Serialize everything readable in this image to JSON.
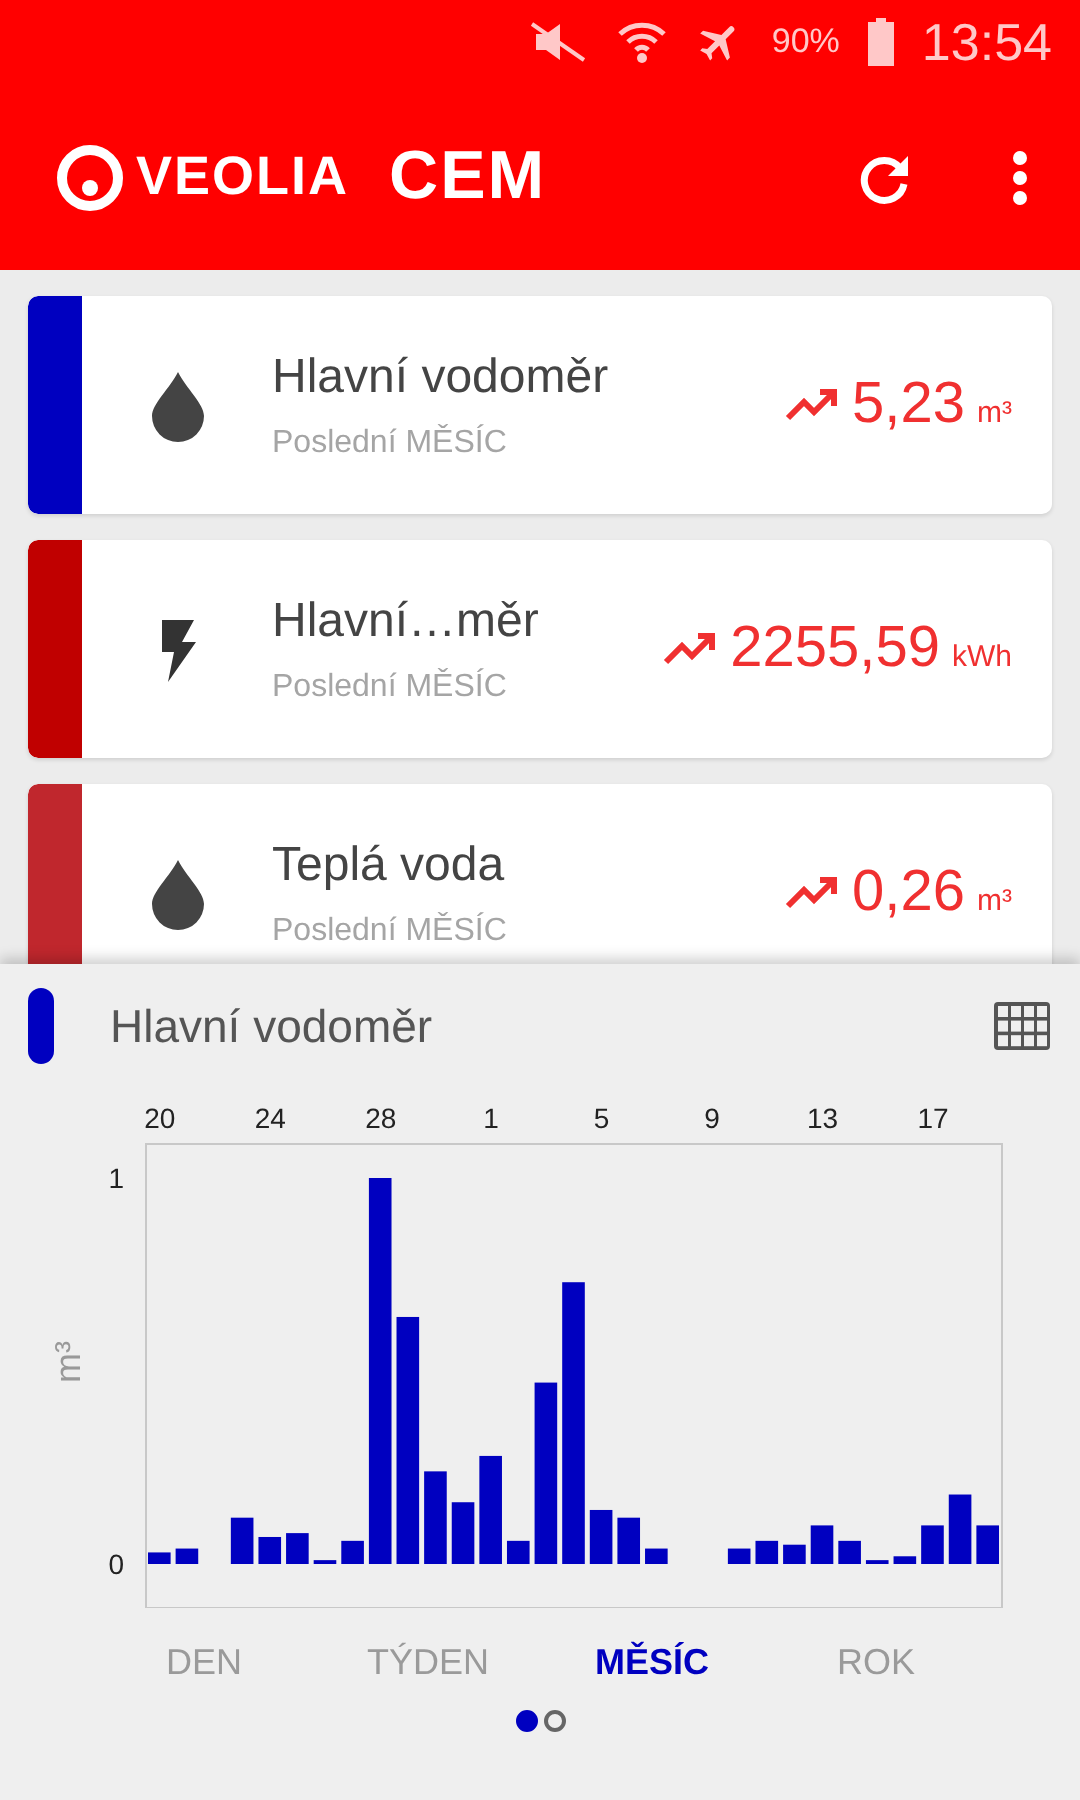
{
  "status_bar": {
    "battery": "90%",
    "time": "13:54"
  },
  "app_bar": {
    "logo_text": "VEOLIA",
    "logo_secondary": "CEM"
  },
  "meters": [
    {
      "kind": "water",
      "title": "Hlavní vodoměr",
      "subtitle": "Poslední MĚSÍC",
      "value": "5,23",
      "unit": "m³",
      "color": "#0000c0"
    },
    {
      "kind": "electric",
      "title": "Hlavní…měr",
      "subtitle": "Poslední MĚSÍC",
      "value": "2255,59",
      "unit": "kWh",
      "color": "#c00000"
    },
    {
      "kind": "water",
      "title": "Teplá voda",
      "subtitle": "Poslední MĚSÍC",
      "value": "0,26",
      "unit": "m³",
      "color": "#c0272d"
    }
  ],
  "detail": {
    "title": "Hlavní vodoměr",
    "color": "#0000c0",
    "chart_data": {
      "type": "bar",
      "ylabel": "m³",
      "categories": [
        "20",
        null,
        null,
        null,
        "24",
        null,
        null,
        null,
        "28",
        null,
        null,
        null,
        "1",
        null,
        null,
        null,
        "5",
        null,
        null,
        null,
        "9",
        null,
        null,
        null,
        "13",
        null,
        null,
        null,
        "17",
        null,
        null
      ],
      "series": [
        {
          "color": "#0000c0",
          "values": [
            0.03,
            0.04,
            0,
            0.12,
            0.07,
            0.08,
            0.01,
            0.06,
            1.0,
            0.64,
            0.24,
            0.16,
            0.28,
            0.06,
            0.47,
            0.73,
            0.14,
            0.12,
            0.04,
            0,
            0,
            0.04,
            0.06,
            0.05,
            0.1,
            0.06,
            0.01,
            0.02,
            0.1,
            0.18,
            0.1
          ]
        }
      ],
      "ylim": [
        0,
        1
      ],
      "yticks": [
        0,
        1
      ]
    },
    "periods": [
      {
        "label": "DEN",
        "selected": false
      },
      {
        "label": "TÝDEN",
        "selected": false
      },
      {
        "label": "MĚSÍC",
        "selected": true
      },
      {
        "label": "ROK",
        "selected": false
      }
    ],
    "pages": [
      {
        "selected": true
      },
      {
        "selected": false
      }
    ]
  }
}
